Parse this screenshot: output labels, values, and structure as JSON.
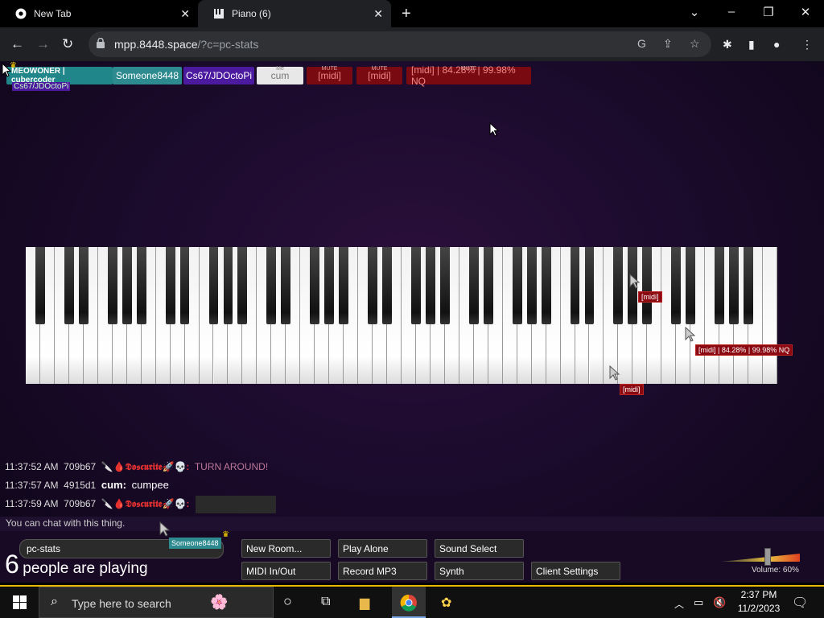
{
  "browser": {
    "tabs": [
      {
        "title": "New Tab"
      },
      {
        "title": "Piano (6)"
      }
    ],
    "url_host": "mpp.8448.space",
    "url_path": "/?c=pc-stats"
  },
  "users": [
    {
      "name": "MEOWONER | cubercoder_",
      "color": "#21868a"
    },
    {
      "name": "Someone8448",
      "color": "#2d8a8f"
    },
    {
      "name": "Cs67/JDOctoPi",
      "color": "#4b1a9e"
    },
    {
      "name": "cum",
      "color": "#e8e8e8",
      "mute": "Me"
    },
    {
      "name": "[midi]",
      "color": "#7a0a12",
      "mute": "MUTE"
    },
    {
      "name": "[midi]",
      "color": "#7a0a12",
      "mute": "MUTE"
    },
    {
      "name": "[midi] | 84.28% | 99.98% NQ",
      "color": "#7a0a12",
      "mute": "MUTE"
    }
  ],
  "owner_sub": "Cs67/JDOctoPi",
  "cursor_tags": [
    "[midi]",
    "[midi] | 84.28% | 99.98% NQ",
    "[midi]"
  ],
  "chat": [
    {
      "time": "11:37:52 AM",
      "id": "709b67",
      "name": "🔪🩸𝕯𝖔𝖘𝖈𝖚𝖗𝖎𝖙𝖊🚀💀:",
      "msg": "TURN AROUND!"
    },
    {
      "time": "11:37:57 AM",
      "id": "4915d1",
      "name": "cum:",
      "msg": "cumpee"
    },
    {
      "time": "11:37:59 AM",
      "id": "709b67",
      "name": "🔪🩸𝕯𝖔𝖘𝖈𝖚𝖗𝖎𝖙𝖊🚀💀:",
      "msg": ""
    }
  ],
  "chat_placeholder": "You can chat with this thing.",
  "room": "pc-stats",
  "room_cursor_label": "Someone8448",
  "people_count": "6",
  "people_text": "people are playing",
  "buttons": {
    "new_room": "New Room...",
    "play_alone": "Play Alone",
    "sound_select": "Sound Select",
    "midi": "MIDI In/Out",
    "record": "Record MP3",
    "synth": "Synth",
    "client_settings": "Client Settings"
  },
  "volume": "Volume: 60%",
  "volume_level": 0.6,
  "taskbar": {
    "search": "Type here to search",
    "time": "2:37 PM",
    "date": "11/2/2023"
  }
}
